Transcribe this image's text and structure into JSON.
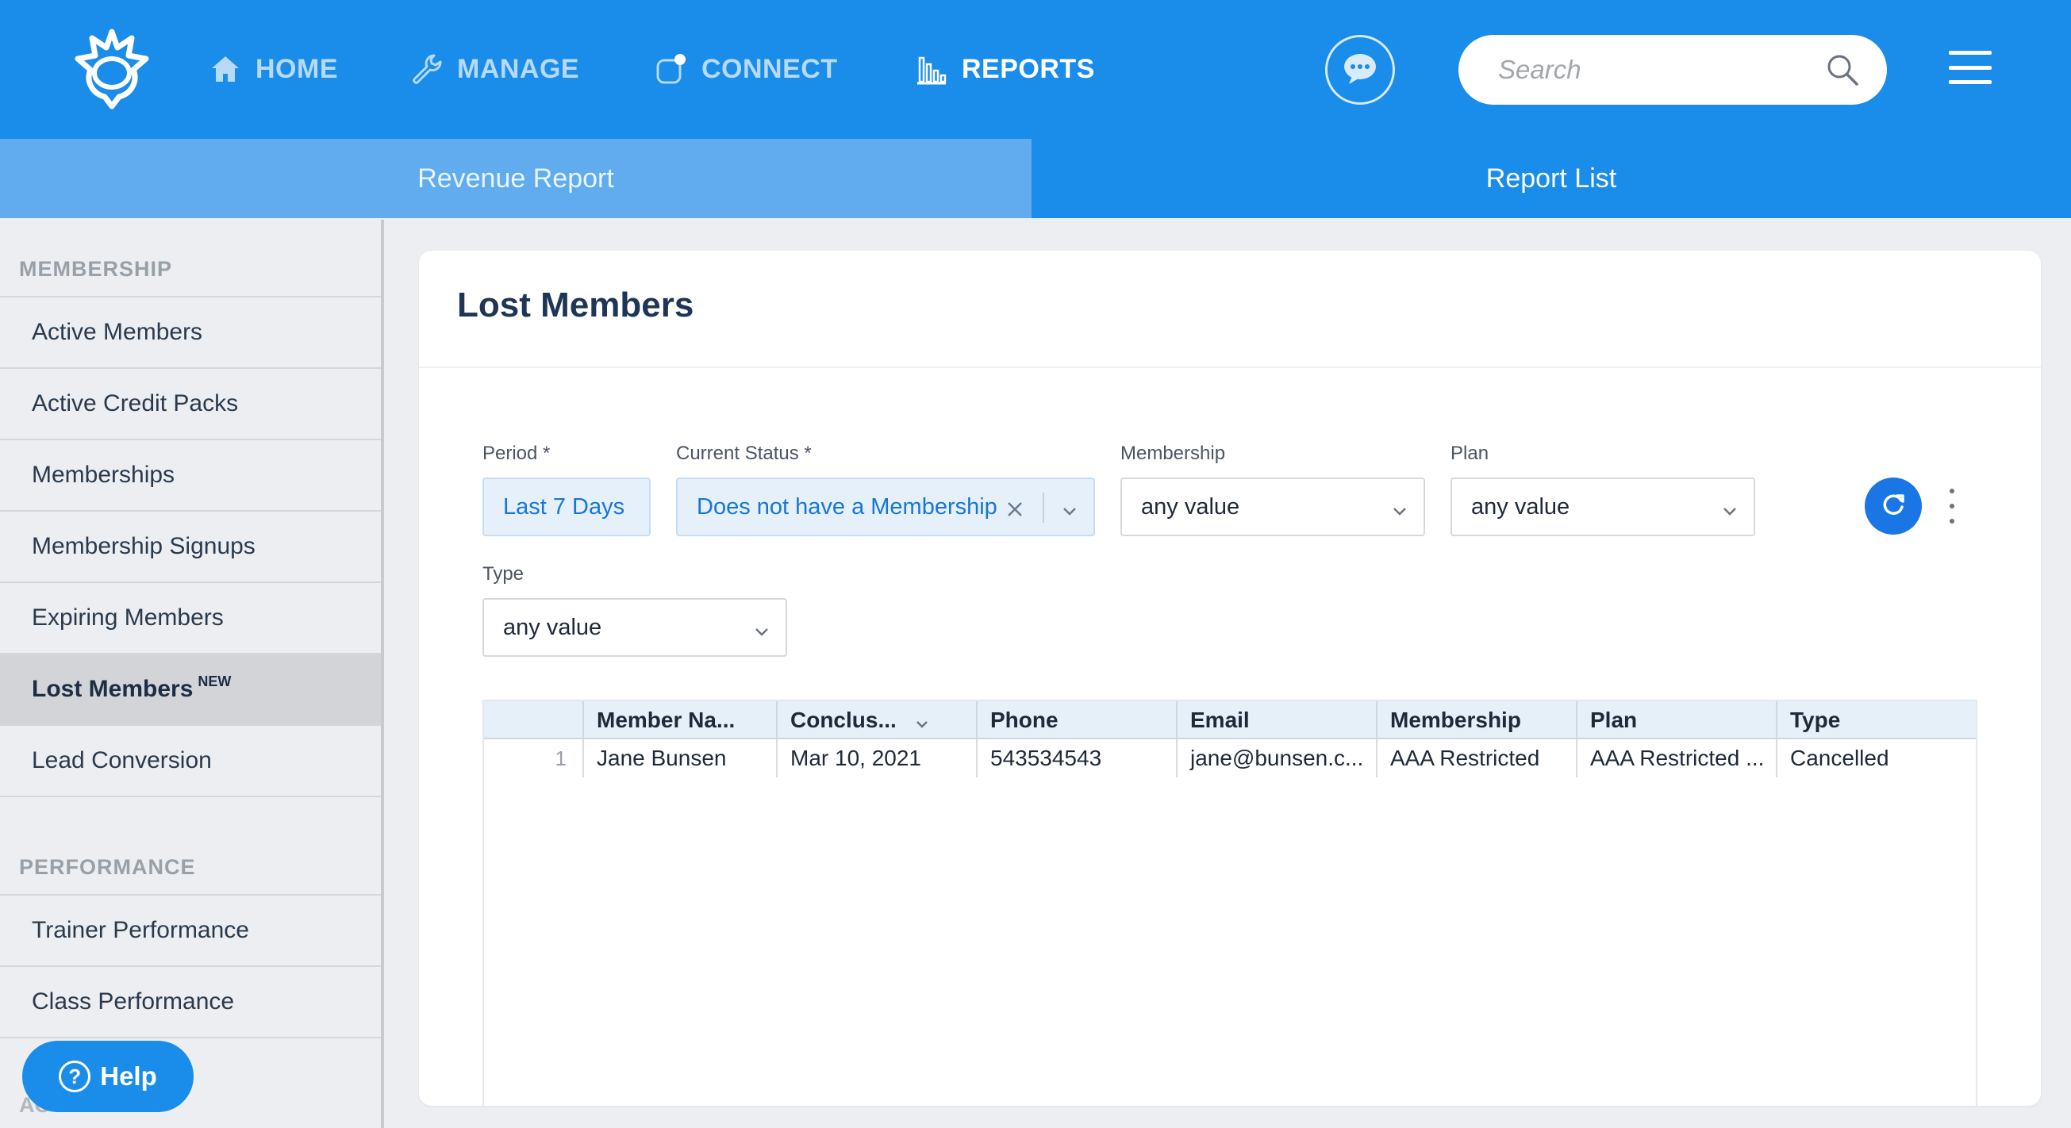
{
  "nav": {
    "home": "HOME",
    "manage": "MANAGE",
    "connect": "CONNECT",
    "reports": "REPORTS"
  },
  "search": {
    "placeholder": "Search"
  },
  "subtabs": {
    "revenue": "Revenue Report",
    "list": "Report List"
  },
  "sidebar": {
    "membership_heading": "MEMBERSHIP",
    "items": [
      {
        "label": "Active Members"
      },
      {
        "label": "Active Credit Packs"
      },
      {
        "label": "Memberships"
      },
      {
        "label": "Membership Signups"
      },
      {
        "label": "Expiring Members"
      },
      {
        "label": "Lost Members",
        "badge": "NEW"
      },
      {
        "label": "Lead Conversion"
      }
    ],
    "performance_heading": "PERFORMANCE",
    "performance_items": [
      {
        "label": "Trainer Performance"
      },
      {
        "label": "Class Performance"
      }
    ],
    "cut_heading": "AC",
    "help": "Help"
  },
  "report": {
    "title": "Lost Members",
    "filters": {
      "period": {
        "label": "Period *",
        "value": "Last 7 Days"
      },
      "status": {
        "label": "Current Status *",
        "value": "Does not have a Membership"
      },
      "membership": {
        "label": "Membership",
        "value": "any value"
      },
      "plan": {
        "label": "Plan",
        "value": "any value"
      },
      "type": {
        "label": "Type",
        "value": "any value"
      }
    },
    "table": {
      "columns": [
        "Member Na...",
        "Conclus...",
        "Phone",
        "Email",
        "Membership",
        "Plan",
        "Type"
      ],
      "rows": [
        {
          "num": "1",
          "cells": [
            "Jane Bunsen",
            "Mar 10, 2021",
            "543534543",
            "jane@bunsen.c...",
            "AAA Restricted",
            "AAA Restricted ...",
            "Cancelled"
          ]
        }
      ]
    }
  },
  "colors": {
    "brand": "#1a8ce9",
    "active_tab": "#60acef",
    "accent": "#1a76e4"
  }
}
